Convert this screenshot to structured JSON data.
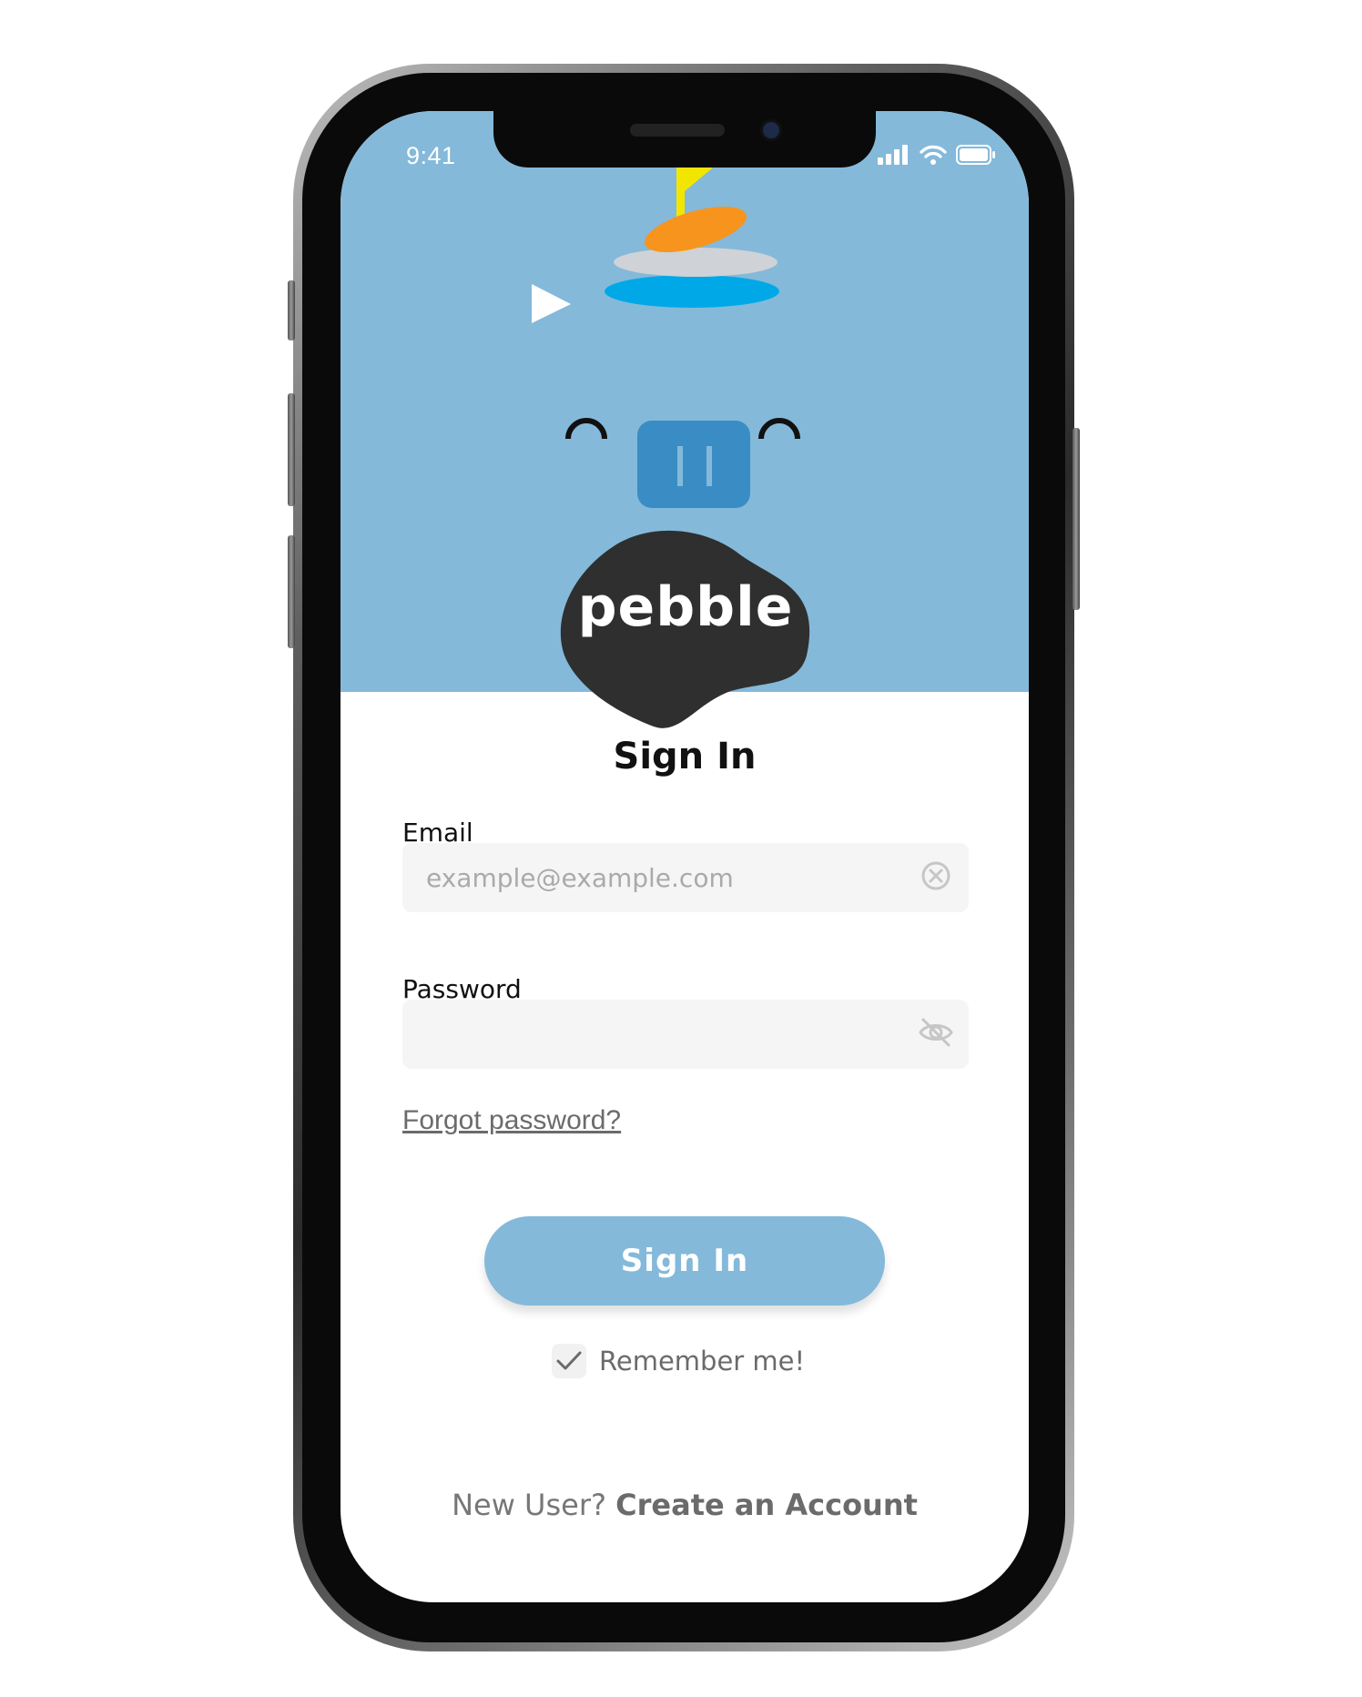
{
  "status_bar": {
    "time": "9:41",
    "icons": [
      "signal-icon",
      "wifi-icon",
      "battery-icon"
    ]
  },
  "brand": {
    "logo_text": "pebble",
    "colors": {
      "hero": "#84b9da",
      "blob": "#2f2f2f",
      "accent_orange": "#f7941d",
      "flag_yellow": "#f2e600",
      "pool_blue": "#00a8e8"
    }
  },
  "form": {
    "title": "Sign In",
    "email": {
      "label": "Email",
      "placeholder": "example@example.com",
      "value": ""
    },
    "password": {
      "label": "Password",
      "value": ""
    },
    "forgot_label": "Forgot password?",
    "submit_label": "Sign In",
    "remember": {
      "label": "Remember me!",
      "checked": true
    }
  },
  "footer": {
    "prompt": "New User?",
    "link": "Create an Account"
  }
}
